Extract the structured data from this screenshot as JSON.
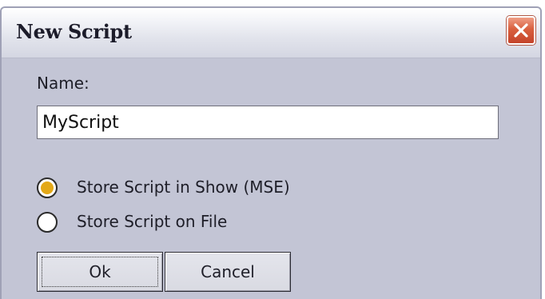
{
  "window": {
    "title": "New Script"
  },
  "form": {
    "name_label": "Name:",
    "name_value": "MyScript",
    "options": [
      {
        "label": "Store Script in Show (MSE)",
        "checked": true
      },
      {
        "label": "Store Script on File",
        "checked": false
      }
    ]
  },
  "buttons": {
    "ok_label": "Ok",
    "cancel_label": "Cancel"
  },
  "colors": {
    "dialog_background": "#c3c5d5",
    "radio_selected": "#e3a818",
    "close_button": "#d9603f"
  }
}
